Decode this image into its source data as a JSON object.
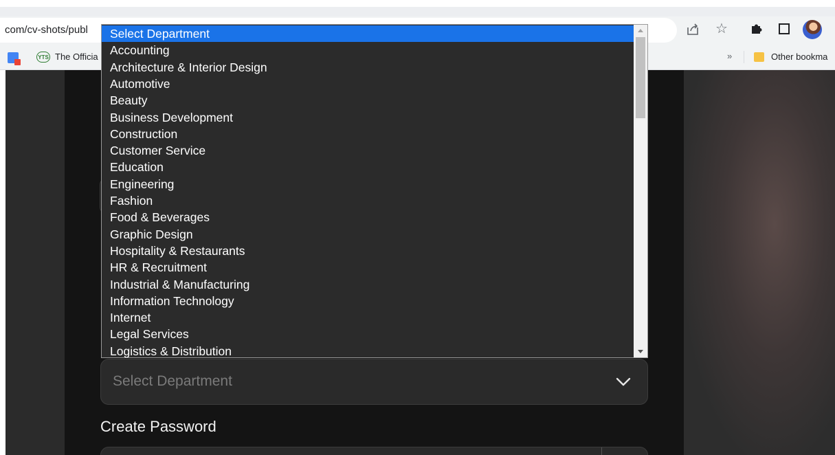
{
  "browser": {
    "url_visible": "com/cv-shots/publ",
    "bookmarks": [
      {
        "label": "The Officia"
      }
    ],
    "overflow_chevron": "»",
    "other_bookmarks": "Other bookma"
  },
  "form": {
    "department_placeholder": "Select Department",
    "password_label": "Create Password"
  },
  "dropdown": {
    "selected_index": 0,
    "options": [
      "Select Department",
      "Accounting",
      "Architecture & Interior Design",
      "Automotive",
      "Beauty",
      "Business Development",
      "Construction",
      "Customer Service",
      "Education",
      "Engineering",
      "Fashion",
      "Food & Beverages",
      "Graphic Design",
      "Hospitality & Restaurants",
      "HR & Recruitment",
      "Industrial & Manufacturing",
      "Information Technology",
      "Internet",
      "Legal Services",
      "Logistics & Distribution"
    ]
  },
  "colors": {
    "selection_highlight": "#1a73e8",
    "page_background": "#141414"
  }
}
